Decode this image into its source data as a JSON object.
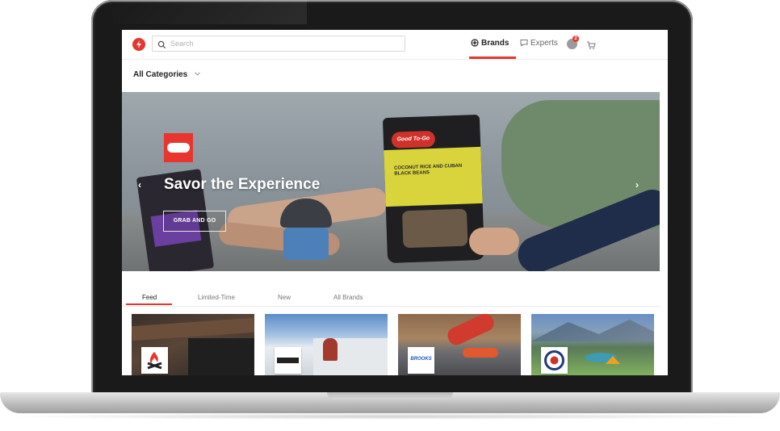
{
  "topbar": {
    "search_placeholder": "Search",
    "nav_brands_label": "Brands",
    "nav_experts_label": "Experts",
    "notification_count": "2"
  },
  "categories": {
    "label": "All Categories"
  },
  "hero": {
    "title": "Savor the Experience",
    "cta_label": "GRAB AND GO",
    "pouch_text": "COCONUT RICE AND CUBAN BLACK BEANS",
    "pouch_brand": "Good To-Go"
  },
  "tabs": [
    "Feed",
    "Limited-Time",
    "New",
    "All Brands"
  ],
  "cards": [
    {
      "logo_text": "",
      "icon": "campfire-icon"
    },
    {
      "logo_text": "",
      "icon": "bike-brand-logo"
    },
    {
      "logo_text": "BROOKS",
      "icon": "brooks-logo"
    },
    {
      "logo_text": "",
      "icon": "big-agnes-logo"
    }
  ],
  "colors": {
    "accent": "#e8352e",
    "text": "#222222",
    "muted": "#777777"
  }
}
